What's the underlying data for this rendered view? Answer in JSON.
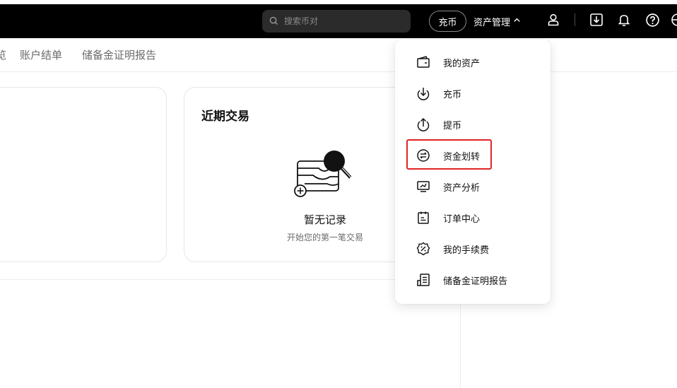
{
  "topbar": {
    "search_placeholder": "搜索币对",
    "deposit_label": "充币",
    "asset_mgmt_label": "资产管理"
  },
  "subnav": {
    "items": [
      {
        "label": "览"
      },
      {
        "label": "账户结单"
      },
      {
        "label": "储备金证明报告"
      }
    ]
  },
  "recent_card": {
    "title": "近期交易",
    "empty_title": "暂无记录",
    "empty_subtitle": "开始您的第一笔交易"
  },
  "dropdown": {
    "items": [
      {
        "label": "我的资产",
        "icon": "wallet-icon"
      },
      {
        "label": "充币",
        "icon": "deposit-icon"
      },
      {
        "label": "提币",
        "icon": "withdraw-icon"
      },
      {
        "label": "资金划转",
        "icon": "transfer-icon"
      },
      {
        "label": "资产分析",
        "icon": "analysis-icon"
      },
      {
        "label": "订单中心",
        "icon": "order-icon"
      },
      {
        "label": "我的手续费",
        "icon": "fee-icon"
      },
      {
        "label": "储备金证明报告",
        "icon": "report-icon"
      }
    ],
    "highlighted": "资金划转"
  },
  "colors": {
    "topbar_bg": "#000000",
    "highlight": "#e02424"
  }
}
